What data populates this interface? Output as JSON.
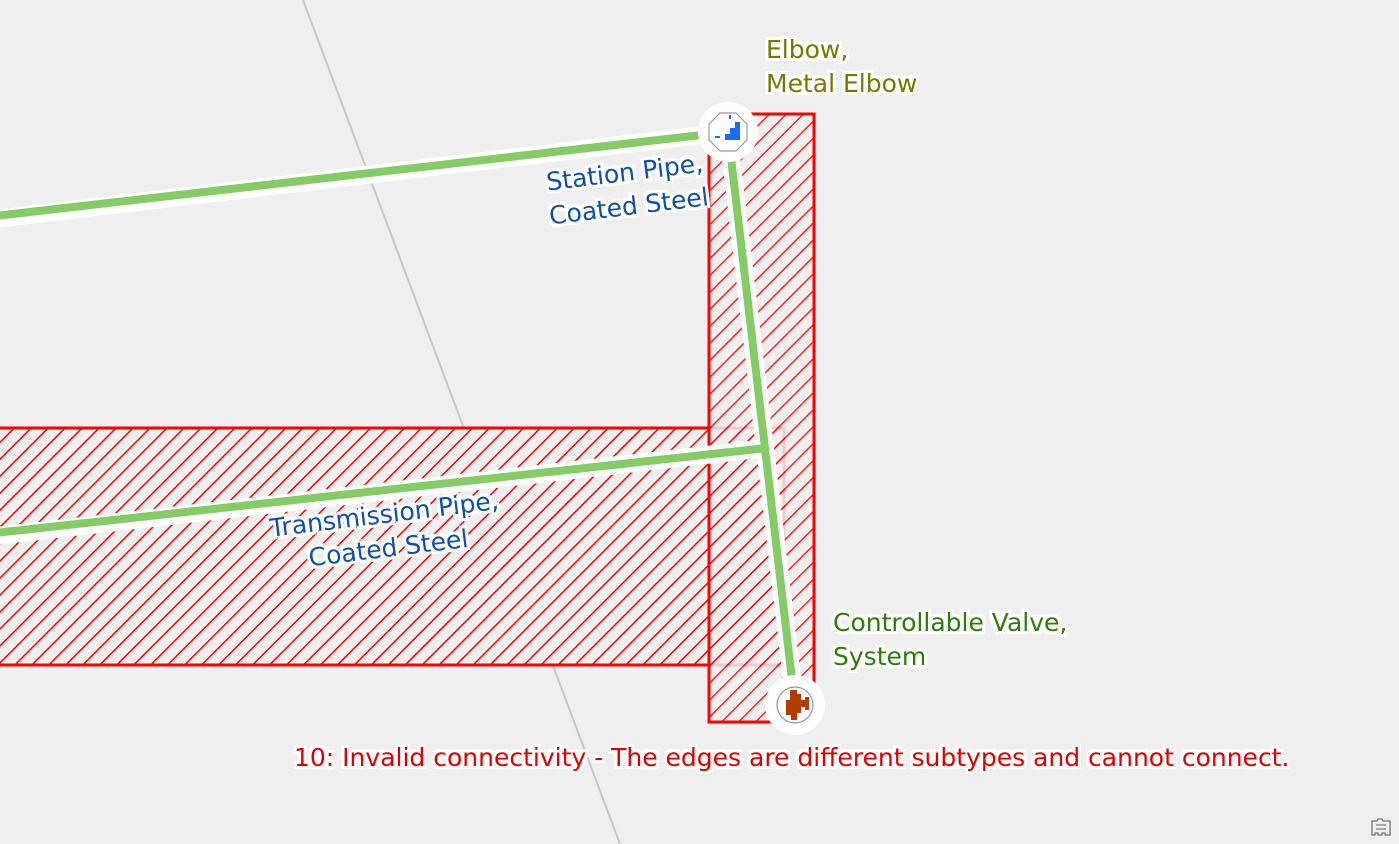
{
  "map": {
    "background_color": "#efefef",
    "features": {
      "pipes": [
        {
          "name": "Station Pipe",
          "subtype": "Coated Steel",
          "color": "#85cc67"
        },
        {
          "name": "Transmission Pipe",
          "subtype": "Coated Steel",
          "color": "#85cc67"
        }
      ],
      "devices": [
        {
          "name": "Elbow",
          "subtype": "Metal Elbow",
          "icon": "elbow-fitting-icon",
          "color": "#1a6ff0"
        },
        {
          "name": "Controllable Valve",
          "subtype": "System",
          "icon": "valve-icon",
          "color": "#b53c00"
        }
      ],
      "error_polygons": {
        "color": "#ff0000",
        "fill": "hatched"
      }
    }
  },
  "labels": {
    "elbow": {
      "line1": "Elbow,",
      "line2": "Metal Elbow",
      "color": "#7a7800"
    },
    "station_pipe": {
      "line1": "Station Pipe,",
      "line2": "Coated Steel",
      "color": "#1150a8"
    },
    "transmission_pipe": {
      "line1": "Transmission Pipe,",
      "line2": "Coated Steel",
      "color": "#1150a8"
    },
    "valve": {
      "line1": "Controllable Valve,",
      "line2": "System",
      "color": "#2e7d0a"
    },
    "error": {
      "text": "10: Invalid connectivity - The edges are different subtypes and cannot connect.",
      "color": "#e10000"
    }
  },
  "corner_control": {
    "icon": "map-layer-icon"
  }
}
